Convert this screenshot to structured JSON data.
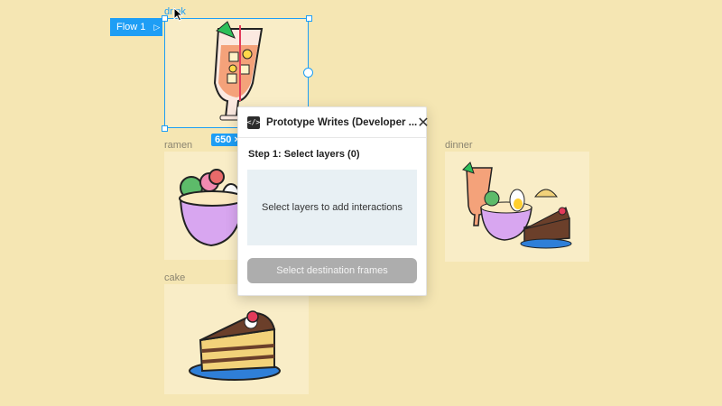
{
  "flow": {
    "label": "Flow 1"
  },
  "frames": {
    "drink": "drink",
    "ramen": "ramen",
    "dinner": "dinner",
    "cake": "cake"
  },
  "selection": {
    "size": "650 ×"
  },
  "dialog": {
    "icon": "</>",
    "title": "Prototype Writes (Developer ...",
    "close": "✕",
    "step": "Step 1: Select layers (0)",
    "dropzone_text": "Select layers to add interactions",
    "button_label": "Select destination frames"
  },
  "colors": {
    "canvas": "#f5e6b3",
    "frame": "#f9edc7",
    "selection": "#1e9ef5",
    "button_disabled": "#adadad"
  }
}
